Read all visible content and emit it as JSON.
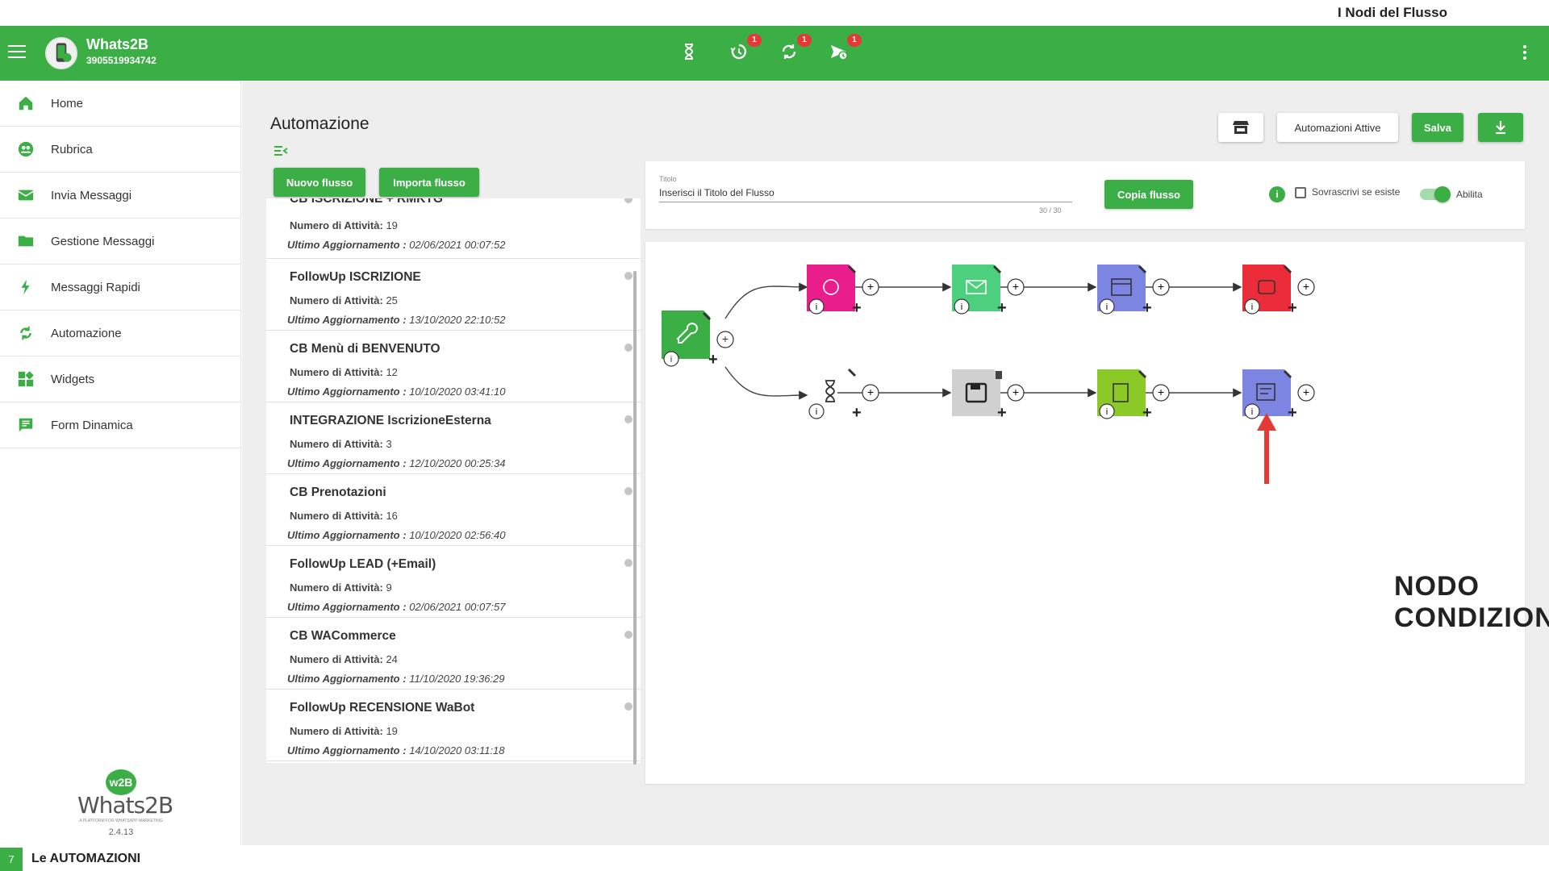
{
  "slide": {
    "title": "I Nodi del Flusso",
    "page_number": "7",
    "section": "Le AUTOMAZIONI"
  },
  "appbar": {
    "app_name": "Whats2B",
    "phone": "3905519934742",
    "icons": [
      {
        "name": "hourglass-icon",
        "badge": ""
      },
      {
        "name": "history-icon",
        "badge": "1"
      },
      {
        "name": "sync-icon",
        "badge": "1"
      },
      {
        "name": "scheduled-send-icon",
        "badge": "1"
      }
    ]
  },
  "sidebar": {
    "items": [
      {
        "label": "Home",
        "icon": "home-icon"
      },
      {
        "label": "Rubrica",
        "icon": "contacts-icon"
      },
      {
        "label": "Invia Messaggi",
        "icon": "mail-icon"
      },
      {
        "label": "Gestione Messaggi",
        "icon": "folder-icon"
      },
      {
        "label": "Messaggi Rapidi",
        "icon": "bolt-icon"
      },
      {
        "label": "Automazione",
        "icon": "sync-icon"
      },
      {
        "label": "Widgets",
        "icon": "widgets-icon"
      },
      {
        "label": "Form Dinamica",
        "icon": "form-icon"
      }
    ],
    "logo_text": "Whats2B",
    "logo_badge": "w2B",
    "logo_tagline": "A PLATFORM FOR WHATSAPP MARKETING",
    "version": "2.4.13"
  },
  "main": {
    "title": "Automazione",
    "new_flow_label": "Nuovo flusso",
    "import_flow_label": "Importa flusso",
    "flows": [
      {
        "name": "CB ISCRIZIONE + RMKTG",
        "count_label": "Numero di Attività:",
        "count": "19",
        "date_label": "Ultimo Aggiornamento :",
        "date": "02/06/2021 00:07:52"
      },
      {
        "name": "FollowUp ISCRIZIONE",
        "count_label": "Numero di Attività:",
        "count": "25",
        "date_label": "Ultimo Aggiornamento :",
        "date": "13/10/2020 22:10:52"
      },
      {
        "name": "CB Menù di BENVENUTO",
        "count_label": "Numero di Attività:",
        "count": "12",
        "date_label": "Ultimo Aggiornamento :",
        "date": "10/10/2020 03:41:10"
      },
      {
        "name": "INTEGRAZIONE IscrizioneEsterna",
        "count_label": "Numero di Attività:",
        "count": "3",
        "date_label": "Ultimo Aggiornamento :",
        "date": "12/10/2020 00:25:34"
      },
      {
        "name": "CB Prenotazioni",
        "count_label": "Numero di Attività:",
        "count": "16",
        "date_label": "Ultimo Aggiornamento :",
        "date": "10/10/2020 02:56:40"
      },
      {
        "name": "FollowUp LEAD (+Email)",
        "count_label": "Numero di Attività:",
        "count": "9",
        "date_label": "Ultimo Aggiornamento :",
        "date": "02/06/2021 00:07:57"
      },
      {
        "name": "CB WACommerce",
        "count_label": "Numero di Attività:",
        "count": "24",
        "date_label": "Ultimo Aggiornamento :",
        "date": "11/10/2020 19:36:29"
      },
      {
        "name": "FollowUp RECENSIONE WaBot",
        "count_label": "Numero di Attività:",
        "count": "19",
        "date_label": "Ultimo Aggiornamento :",
        "date": "14/10/2020 03:11:18"
      }
    ]
  },
  "toolbar": {
    "store_icon": "store-icon",
    "active_automations_label": "Automazioni Attive",
    "save_label": "Salva",
    "download_icon": "download-icon"
  },
  "header": {
    "title_label": "Titolo",
    "title_value": "Inserisci il Titolo del Flusso",
    "title_counter": "30 / 30",
    "copy_label": "Copia flusso",
    "info_icon": "i",
    "overwrite_label": "Sovrascrivi se esiste",
    "overwrite_checked": false,
    "enable_label": "Abilita",
    "enabled": true
  },
  "flow_nodes": [
    {
      "name": "trigger-node",
      "icon": "key-icon",
      "color": "#3bae46"
    },
    {
      "name": "ai-node",
      "icon": "brain-icon",
      "color": "#e91e8c"
    },
    {
      "name": "email-node",
      "icon": "envelope-icon",
      "color": "#4cd07d"
    },
    {
      "name": "calendar-node",
      "icon": "calendar-icon",
      "color": "#7d85e3"
    },
    {
      "name": "robot-node",
      "icon": "robot-icon",
      "color": "#ec2c39"
    },
    {
      "name": "delay-node",
      "icon": "hourglass-icon",
      "color": "#ffffff"
    },
    {
      "name": "save-node",
      "icon": "floppy-icon",
      "color": "#d0d0d0"
    },
    {
      "name": "data-node",
      "icon": "document-icon",
      "color": "#8ac926"
    },
    {
      "name": "conditions-node",
      "icon": "conditions-icon",
      "color": "#7d85e3"
    }
  ],
  "annotation": {
    "label": "NODO CONDIZIONI",
    "arrow_color": "#e53935"
  }
}
